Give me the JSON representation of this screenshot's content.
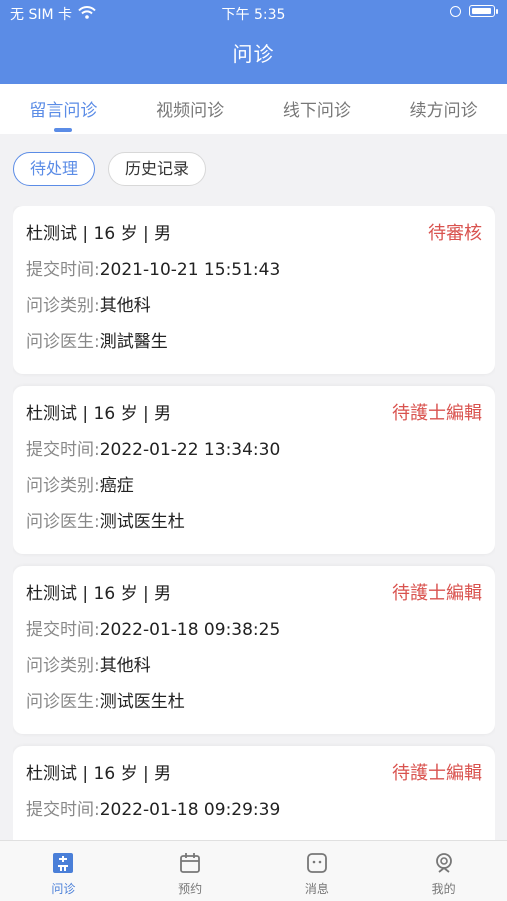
{
  "status_bar": {
    "carrier": "无 SIM 卡",
    "time": "下午 5:35"
  },
  "header": {
    "title": "问诊"
  },
  "tabs": [
    {
      "label": "留言问诊",
      "active": true
    },
    {
      "label": "视频问诊",
      "active": false
    },
    {
      "label": "线下问诊",
      "active": false
    },
    {
      "label": "续方问诊",
      "active": false
    }
  ],
  "filters": [
    {
      "label": "待处理",
      "active": true
    },
    {
      "label": "历史记录",
      "active": false
    }
  ],
  "labels": {
    "submit_time": "提交时间:",
    "category": "问诊类别:",
    "doctor": "问诊医生:"
  },
  "cards": [
    {
      "patient": "杜测试 | 16 岁 | 男",
      "status": "待審核",
      "submit_time": "2021-10-21 15:51:43",
      "category": "其他科",
      "doctor": "測試醫生"
    },
    {
      "patient": "杜测试 | 16 岁 | 男",
      "status": "待護士編輯",
      "submit_time": "2022-01-22 13:34:30",
      "category": "癌症",
      "doctor": "测试医生杜"
    },
    {
      "patient": "杜测试 | 16 岁 | 男",
      "status": "待護士編輯",
      "submit_time": "2022-01-18 09:38:25",
      "category": "其他科",
      "doctor": "测试医生杜"
    },
    {
      "patient": "杜测试 | 16 岁 | 男",
      "status": "待護士編輯",
      "submit_time": "2022-01-18 09:29:39",
      "category": "",
      "doctor": ""
    }
  ],
  "tabbar": [
    {
      "label": "问诊",
      "icon": "consult-icon",
      "active": true
    },
    {
      "label": "预约",
      "icon": "calendar-icon",
      "active": false
    },
    {
      "label": "消息",
      "icon": "message-icon",
      "active": false
    },
    {
      "label": "我的",
      "icon": "profile-icon",
      "active": false
    }
  ],
  "colors": {
    "primary": "#5b8ce6",
    "status_red": "#d9534f"
  }
}
